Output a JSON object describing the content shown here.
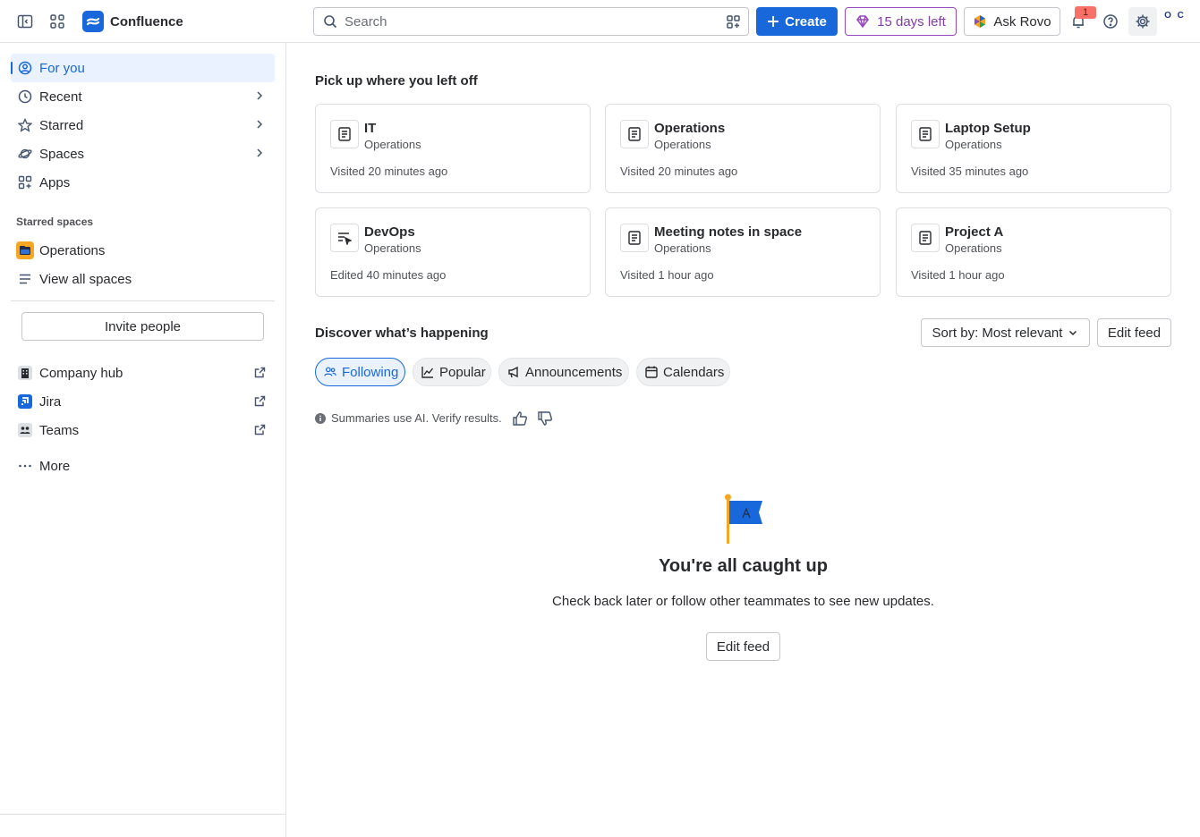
{
  "app": {
    "name": "Confluence",
    "brand_color": "#1868db"
  },
  "topbar": {
    "search_placeholder": "Search",
    "create_label": "Create",
    "trial_label": "15 days left",
    "rovo_label": "Ask Rovo",
    "notification_count": "1",
    "avatar_initials": "O C"
  },
  "sidebar": {
    "items": [
      {
        "label": "For you",
        "icon": "person-circle-icon",
        "active": true
      },
      {
        "label": "Recent",
        "icon": "clock-icon"
      },
      {
        "label": "Starred",
        "icon": "star-icon"
      },
      {
        "label": "Spaces",
        "icon": "planet-icon"
      },
      {
        "label": "Apps",
        "icon": "apps-icon"
      }
    ],
    "starred_spaces_label": "Starred spaces",
    "starred_spaces": [
      {
        "label": "Operations",
        "icon": "folder-space-icon",
        "icon_color": "#f5a623"
      }
    ],
    "view_all_spaces_label": "View all spaces",
    "invite_label": "Invite people",
    "external_links": [
      {
        "label": "Company hub",
        "icon": "building-icon"
      },
      {
        "label": "Jira",
        "icon": "jira-icon"
      },
      {
        "label": "Teams",
        "icon": "teams-icon"
      }
    ],
    "more_label": "More"
  },
  "main": {
    "recent_heading": "Pick up where you left off",
    "recent_cards": [
      {
        "title": "IT",
        "space": "Operations",
        "meta": "Visited 20 minutes ago",
        "icon": "page-icon"
      },
      {
        "title": "Operations",
        "space": "Operations",
        "meta": "Visited 20 minutes ago",
        "icon": "page-icon"
      },
      {
        "title": "Laptop Setup",
        "space": "Operations",
        "meta": "Visited 35 minutes ago",
        "icon": "page-icon"
      },
      {
        "title": "DevOps",
        "space": "Operations",
        "meta": "Edited 40 minutes ago",
        "icon": "page-edit-icon"
      },
      {
        "title": "Meeting notes in space",
        "space": "Operations",
        "meta": "Visited 1 hour ago",
        "icon": "page-icon"
      },
      {
        "title": "Project A",
        "space": "Operations",
        "meta": "Visited 1 hour ago",
        "icon": "page-icon"
      }
    ],
    "discover_heading": "Discover what’s happening",
    "sort_label": "Sort by: Most relevant",
    "edit_feed_label": "Edit feed",
    "tabs": [
      {
        "label": "Following",
        "icon": "people-icon",
        "active": true
      },
      {
        "label": "Popular",
        "icon": "trend-icon"
      },
      {
        "label": "Announcements",
        "icon": "megaphone-icon"
      },
      {
        "label": "Calendars",
        "icon": "calendar-icon"
      }
    ],
    "ai_note": "Summaries use AI. Verify results.",
    "empty_title": "You're all caught up",
    "empty_desc": "Check back later or follow other teammates to see new updates.",
    "empty_button": "Edit feed"
  }
}
